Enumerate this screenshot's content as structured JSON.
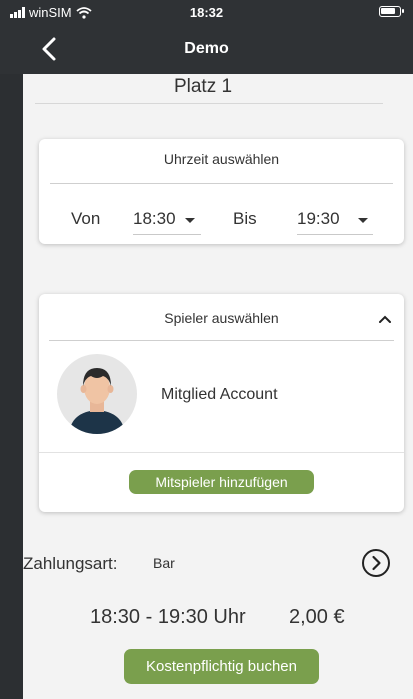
{
  "status_bar": {
    "carrier": "winSIM",
    "time": "18:32"
  },
  "nav": {
    "title": "Demo"
  },
  "court": {
    "name": "Platz 1"
  },
  "time_card": {
    "title": "Uhrzeit auswählen",
    "from_label": "Von",
    "from_value": "18:30",
    "to_label": "Bis",
    "to_value": "19:30"
  },
  "player_card": {
    "title": "Spieler auswählen",
    "member_name": "Mitglied Account",
    "add_button": "Mitspieler hinzufügen"
  },
  "payment": {
    "label": "Zahlungsart:",
    "method": "Bar"
  },
  "summary": {
    "time_range": "18:30 - 19:30 Uhr",
    "price": "2,00 €"
  },
  "book_button": "Kostenpflichtig buchen",
  "colors": {
    "accent_green": "#7a9f4d",
    "header_bg": "#2f3235"
  }
}
